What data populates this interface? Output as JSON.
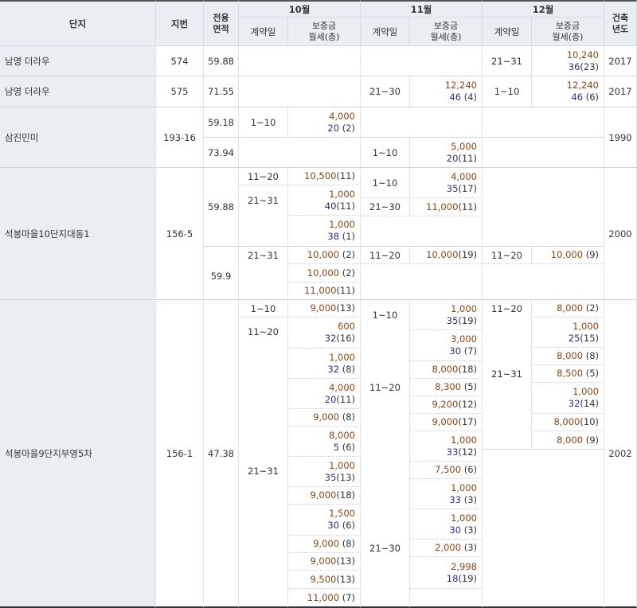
{
  "headers": {
    "complex": "단지",
    "lot": "지번",
    "area_l1": "전용",
    "area_l2": "면적",
    "months": [
      "10월",
      "11월",
      "12월"
    ],
    "contract_day": "계약일",
    "deposit": "보증금",
    "rent_floor": "월세(층)",
    "year_l1": "건축",
    "year_l2": "년도"
  },
  "rows": {
    "namyeong574": {
      "name": "남명 더라우",
      "lot": "574",
      "area": "59.88",
      "year": "2017"
    },
    "namyeong575": {
      "name": "남명 더라우",
      "lot": "575",
      "area": "71.55",
      "year": "2017"
    },
    "samjin": {
      "name": "삼진민미",
      "lot": "193-16",
      "area_a": "59.18",
      "area_b": "73.94",
      "year": "1990"
    },
    "seokbong10": {
      "name": "석봉마을10단지대동1",
      "lot": "156-5",
      "area_a": "59.88",
      "area_b": "59.9",
      "year": "2000"
    },
    "seokbong9": {
      "name": "석봉마을9단지부영5차",
      "lot": "156-1",
      "area": "47.38",
      "year": "2002"
    }
  },
  "days": {
    "d21_31": "21~31",
    "d21_30": "21~30",
    "d1_10": "1~10",
    "d11_20": "11~20"
  },
  "deals": {
    "n574_dec": {
      "deposit": "10,240",
      "rent": "36",
      "floor": "(23)"
    },
    "n575_nov": {
      "deposit": "12,240",
      "rent": "46",
      "floor": "(4)"
    },
    "n575_dec": {
      "deposit": "12,240",
      "rent": "46",
      "floor": "(6)"
    },
    "sj_oct": {
      "deposit": "4,000",
      "rent": "20",
      "floor": "(2)"
    },
    "sj_nov": {
      "deposit": "5,000",
      "rent": "20",
      "floor": "(11)"
    },
    "s10_oct1": {
      "deposit": "10,500",
      "floor": "(11)"
    },
    "s10_oct2": {
      "deposit": "1,000",
      "rent": "40",
      "floor": "(11)"
    },
    "s10_oct3": {
      "deposit": "1,000",
      "rent": "38",
      "floor": "(1)"
    },
    "s10_nov1": {
      "deposit": "4,000",
      "rent": "35",
      "floor": "(17)"
    },
    "s10_nov2": {
      "deposit": "11,000",
      "floor": "(11)"
    },
    "s10b_oct1": {
      "deposit": "10,000",
      "floor": "(2)"
    },
    "s10b_oct2": {
      "deposit": "10,000",
      "floor": "(2)"
    },
    "s10b_oct3": {
      "deposit": "11,000",
      "floor": "(11)"
    },
    "s10b_nov": {
      "deposit": "10,000",
      "floor": "(19)"
    },
    "s10b_dec": {
      "deposit": "10,000",
      "floor": "(9)"
    },
    "s9_oct1": {
      "deposit": "9,000",
      "floor": "(13)"
    },
    "s9_oct2": {
      "deposit": "600",
      "rent": "32",
      "floor": "(16)"
    },
    "s9_oct3": {
      "deposit": "1,000",
      "rent": "32",
      "floor": "(8)"
    },
    "s9_oct4": {
      "deposit": "4,000",
      "rent": "20",
      "floor": "(11)"
    },
    "s9_oct5": {
      "deposit": "9,000",
      "floor": "(8)"
    },
    "s9_oct6": {
      "deposit": "8,000",
      "rent": "5",
      "floor": "(6)"
    },
    "s9_oct7": {
      "deposit": "1,000",
      "rent": "35",
      "floor": "(13)"
    },
    "s9_oct8": {
      "deposit": "9,000",
      "floor": "(18)"
    },
    "s9_oct9": {
      "deposit": "1,500",
      "rent": "30",
      "floor": "(6)"
    },
    "s9_oct10": {
      "deposit": "9,000",
      "floor": "(8)"
    },
    "s9_oct11": {
      "deposit": "9,000",
      "floor": "(13)"
    },
    "s9_oct12": {
      "deposit": "9,500",
      "floor": "(13)"
    },
    "s9_oct13": {
      "deposit": "11,000",
      "floor": "(7)"
    },
    "s9_nov1": {
      "deposit": "1,000",
      "rent": "35",
      "floor": "(19)"
    },
    "s9_nov2": {
      "deposit": "3,000",
      "rent": "30",
      "floor": "(7)"
    },
    "s9_nov3": {
      "deposit": "8,000",
      "floor": "(18)"
    },
    "s9_nov4": {
      "deposit": "8,300",
      "floor": "(5)"
    },
    "s9_nov5": {
      "deposit": "9,200",
      "floor": "(12)"
    },
    "s9_nov6": {
      "deposit": "9,000",
      "floor": "(17)"
    },
    "s9_nov7": {
      "deposit": "1,000",
      "rent": "33",
      "floor": "(12)"
    },
    "s9_nov8": {
      "deposit": "7,500",
      "floor": "(6)"
    },
    "s9_nov9": {
      "deposit": "1,000",
      "rent": "33",
      "floor": "(3)"
    },
    "s9_nov10": {
      "deposit": "1,000",
      "rent": "30",
      "floor": "(3)"
    },
    "s9_nov11": {
      "deposit": "2,000",
      "floor": "(3)"
    },
    "s9_nov12": {
      "deposit": "2,998",
      "rent": "18",
      "floor": "(19)"
    },
    "s9_dec1": {
      "deposit": "8,000",
      "floor": "(2)"
    },
    "s9_dec2": {
      "deposit": "1,000",
      "rent": "25",
      "floor": "(15)"
    },
    "s9_dec3": {
      "deposit": "8,000",
      "floor": "(8)"
    },
    "s9_dec4": {
      "deposit": "8,500",
      "floor": "(5)"
    },
    "s9_dec5": {
      "deposit": "1,000",
      "rent": "32",
      "floor": "(14)"
    },
    "s9_dec6": {
      "deposit": "8,000",
      "floor": "(10)"
    },
    "s9_dec7": {
      "deposit": "8,000",
      "floor": "(9)"
    }
  }
}
